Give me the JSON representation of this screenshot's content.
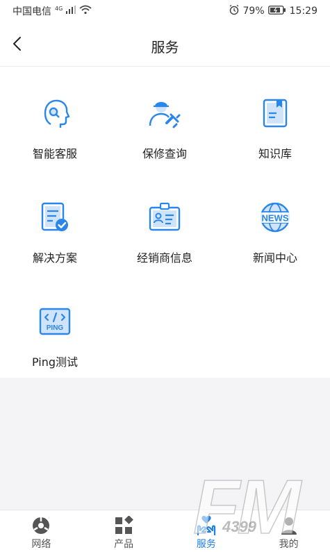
{
  "status_bar": {
    "carrier": "中国电信",
    "network_type": "4G",
    "battery": "79%",
    "time": "15:29"
  },
  "header": {
    "title": "服务"
  },
  "services": [
    {
      "label": "智能客服",
      "icon": "customer-service-icon"
    },
    {
      "label": "保修查询",
      "icon": "warranty-repair-icon"
    },
    {
      "label": "知识库",
      "icon": "knowledge-book-icon"
    },
    {
      "label": "解决方案",
      "icon": "solution-document-icon"
    },
    {
      "label": "经销商信息",
      "icon": "dealer-id-card-icon"
    },
    {
      "label": "新闻中心",
      "icon": "news-globe-icon",
      "icon_text": "NEWS"
    },
    {
      "label": "Ping测试",
      "icon": "ping-code-icon",
      "icon_text": "PING"
    }
  ],
  "tabbar": [
    {
      "label": "网络",
      "icon": "network-icon",
      "active": false
    },
    {
      "label": "产品",
      "icon": "products-icon",
      "active": false
    },
    {
      "label": "服务",
      "icon": "service-hand-icon",
      "active": true
    },
    {
      "label": "我的",
      "icon": "profile-icon",
      "active": false
    }
  ],
  "watermark": {
    "text_large": "FM",
    "text_small": "4399"
  },
  "colors": {
    "accent": "#1d7fe6",
    "icon_blue": "#2a86e8",
    "icon_light": "#cfe4fb",
    "divider": "#ececec"
  }
}
